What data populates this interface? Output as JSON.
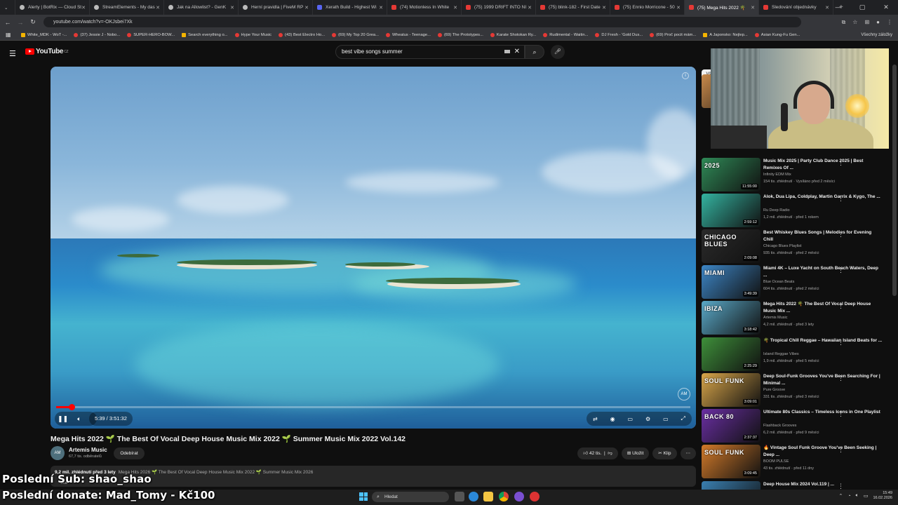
{
  "tabs": [
    {
      "label": "Alerty | BotRix — Cloud St",
      "icon": "generic"
    },
    {
      "label": "StreamElements - My das",
      "icon": "generic"
    },
    {
      "label": "Jak na Allowlist? - GenK",
      "icon": "generic"
    },
    {
      "label": "Herní pravidla | FiveM RP",
      "icon": "generic"
    },
    {
      "label": "Xerath Build - Highest Wi",
      "icon": "discord"
    },
    {
      "label": "(74) Motionless In White",
      "icon": "youtube"
    },
    {
      "label": "(75) 1999 DRIFT INTO NI",
      "icon": "youtube"
    },
    {
      "label": "(75) blink-182 - First Date",
      "icon": "youtube"
    },
    {
      "label": "(75) Ennio Morricone - 50",
      "icon": "youtube"
    },
    {
      "label": "(75) Mega Hits 2022 🌴",
      "icon": "youtube",
      "active": true
    },
    {
      "label": "Sledování objednávky",
      "icon": "youtube"
    }
  ],
  "browser": {
    "url": "youtube.com/watch?v=-OKJsbei7Xk"
  },
  "bookmarks": [
    {
      "label": "White_MDK - WoT -...",
      "type": "folder"
    },
    {
      "label": "(37) Jessie J - Nobo...",
      "type": "yt"
    },
    {
      "label": "SUPER-HERO-BOW...",
      "type": "yt"
    },
    {
      "label": "Search everything o...",
      "type": "folder"
    },
    {
      "label": "Hype Your Music",
      "type": "yt"
    },
    {
      "label": "(43) Best Electro Ho...",
      "type": "yt"
    },
    {
      "label": "(69) My Top 20 Grea...",
      "type": "yt"
    },
    {
      "label": "Wheatus - Teenage...",
      "type": "yt"
    },
    {
      "label": "(69) The Prototypes...",
      "type": "yt"
    },
    {
      "label": "Karate Shotokan Ry...",
      "type": "yt"
    },
    {
      "label": "Rudimental - Waitin...",
      "type": "yt"
    },
    {
      "label": "DJ Fresh - 'Gold Dus...",
      "type": "yt"
    },
    {
      "label": "(69) Proč pocit mám...",
      "type": "yt"
    },
    {
      "label": "A Japonsko: Nejlep...",
      "type": "folder"
    },
    {
      "label": "Asian Kung-Fu Gen...",
      "type": "yt"
    }
  ],
  "bookmarks_all": "Všechny záložky",
  "youtube": {
    "logo": "YouTube",
    "logo_country": "CZ",
    "search_value": "best vibe songs summer"
  },
  "video": {
    "time": "5:39 / 3:51:32",
    "progress_fraction": 0.024,
    "title": "Mega Hits 2022 🌱 The Best Of Vocal Deep House Music Mix 2022 🌱 Summer Music Mix 2022 Vol.142",
    "channel": "Artemis Music",
    "subscribers": "67,7 tis. odběratelů",
    "subscribe_label": "Odebírat",
    "likes": "42 tis.",
    "save_label": "Uložit",
    "clip_label": "Klip",
    "desc_stats": "9,2 mil. zhlédnutí  před 3 lety",
    "desc_tags": "Mega Hits 2026 🌱 The Best Of Vocal Deep House Music Mix 2022 🌱 Summer Music Mix 2026",
    "desc_more": "více"
  },
  "recommendations": [
    {
      "title": "",
      "channel": "",
      "meta": "",
      "duration": "2:02:33",
      "thumb_text": "",
      "color": "#c98a4b"
    },
    {
      "title": "Music Mix 2025 | Party Club Dance 2025 | Best Remixes Of ...",
      "channel": "Infinity EDM Mix",
      "meta": "154 tis. zhlédnutí · Vysíláno před 2 měsíci",
      "duration": "11:55:00",
      "thumb_text": "2025",
      "color": "#2f8a57"
    },
    {
      "title": "Alok, Dua Lipa, Coldplay, Martin Garrix & Kygo, The ...",
      "channel": "Ru Deep Radio",
      "meta": "1,2 mil. zhlédnutí · před 1 rokem",
      "duration": "2:59:12",
      "thumb_text": "",
      "color": "#34b3a0"
    },
    {
      "title": "Best Whiskey Blues Songs | Melodies for Evening Chill",
      "channel": "Chicago Blues Playlist",
      "meta": "935 tis. zhlédnutí · před 2 měsíci",
      "duration": "2:09:08",
      "thumb_text": "CHICAGO BLUES",
      "color": "#2b2b2b"
    },
    {
      "title": "Miami 4K – Luxe Yacht on South Beach Waters, Deep ...",
      "channel": "Blue Ocean Beats",
      "meta": "604 tis. zhlédnutí · před 2 měsíci",
      "duration": "3:49:39",
      "thumb_text": "MIAMI",
      "color": "#3d86c6"
    },
    {
      "title": "Mega Hits 2022 🌴 The Best Of Vocal Deep House Music Mix ...",
      "channel": "Artemis Music",
      "meta": "4,2 mil. zhlédnutí · před 3 lety",
      "duration": "3:18:42",
      "thumb_text": "IBIZA",
      "color": "#5aa9c8"
    },
    {
      "title": "🌴 Tropical Chill Reggae – Hawaiian Island Beats for ...",
      "channel": "Island Reggae Vibes",
      "meta": "1,9 mil. zhlédnutí · před 5 měsíci",
      "duration": "2:25:29",
      "thumb_text": "",
      "color": "#3e8f3a"
    },
    {
      "title": "Deep Soul-Funk Grooves You've Been Searching For | Minimal ...",
      "channel": "Pure Groove",
      "meta": "331 tis. zhlédnutí · před 3 měsíci",
      "duration": "3:09:01",
      "thumb_text": "SOUL FUNK",
      "color": "#d9a64a"
    },
    {
      "title": "Ultimate 80s Classics – Timeless Icons in One Playlist",
      "channel": "Flashback Grooves",
      "meta": "6,2 mil. zhlédnutí · před 9 měsíci",
      "duration": "2:37:37",
      "thumb_text": "BACK 80",
      "color": "#6a2fa3"
    },
    {
      "title": "🔥 Vintage Soul Funk Groove You've Been Seeking | Deep ...",
      "channel": "BOOM PULSE",
      "meta": "43 tis. zhlédnutí · před 11 dny",
      "duration": "3:09:45",
      "thumb_text": "SOUL FUNK",
      "color": "#d27a2a"
    },
    {
      "title": "Deep House Mix 2024 Vol.119 | ...",
      "channel": "",
      "meta": "",
      "duration": "",
      "thumb_text": "",
      "color": "#3a7fb0"
    }
  ],
  "overlay": {
    "last_sub": "Poslední Sub: shao_shao",
    "last_donate": "Poslední donate: Mad_Tomy - Kč100"
  },
  "taskbar": {
    "search_label": "Hledat",
    "time": "15:49",
    "date": "16.02.2026"
  }
}
